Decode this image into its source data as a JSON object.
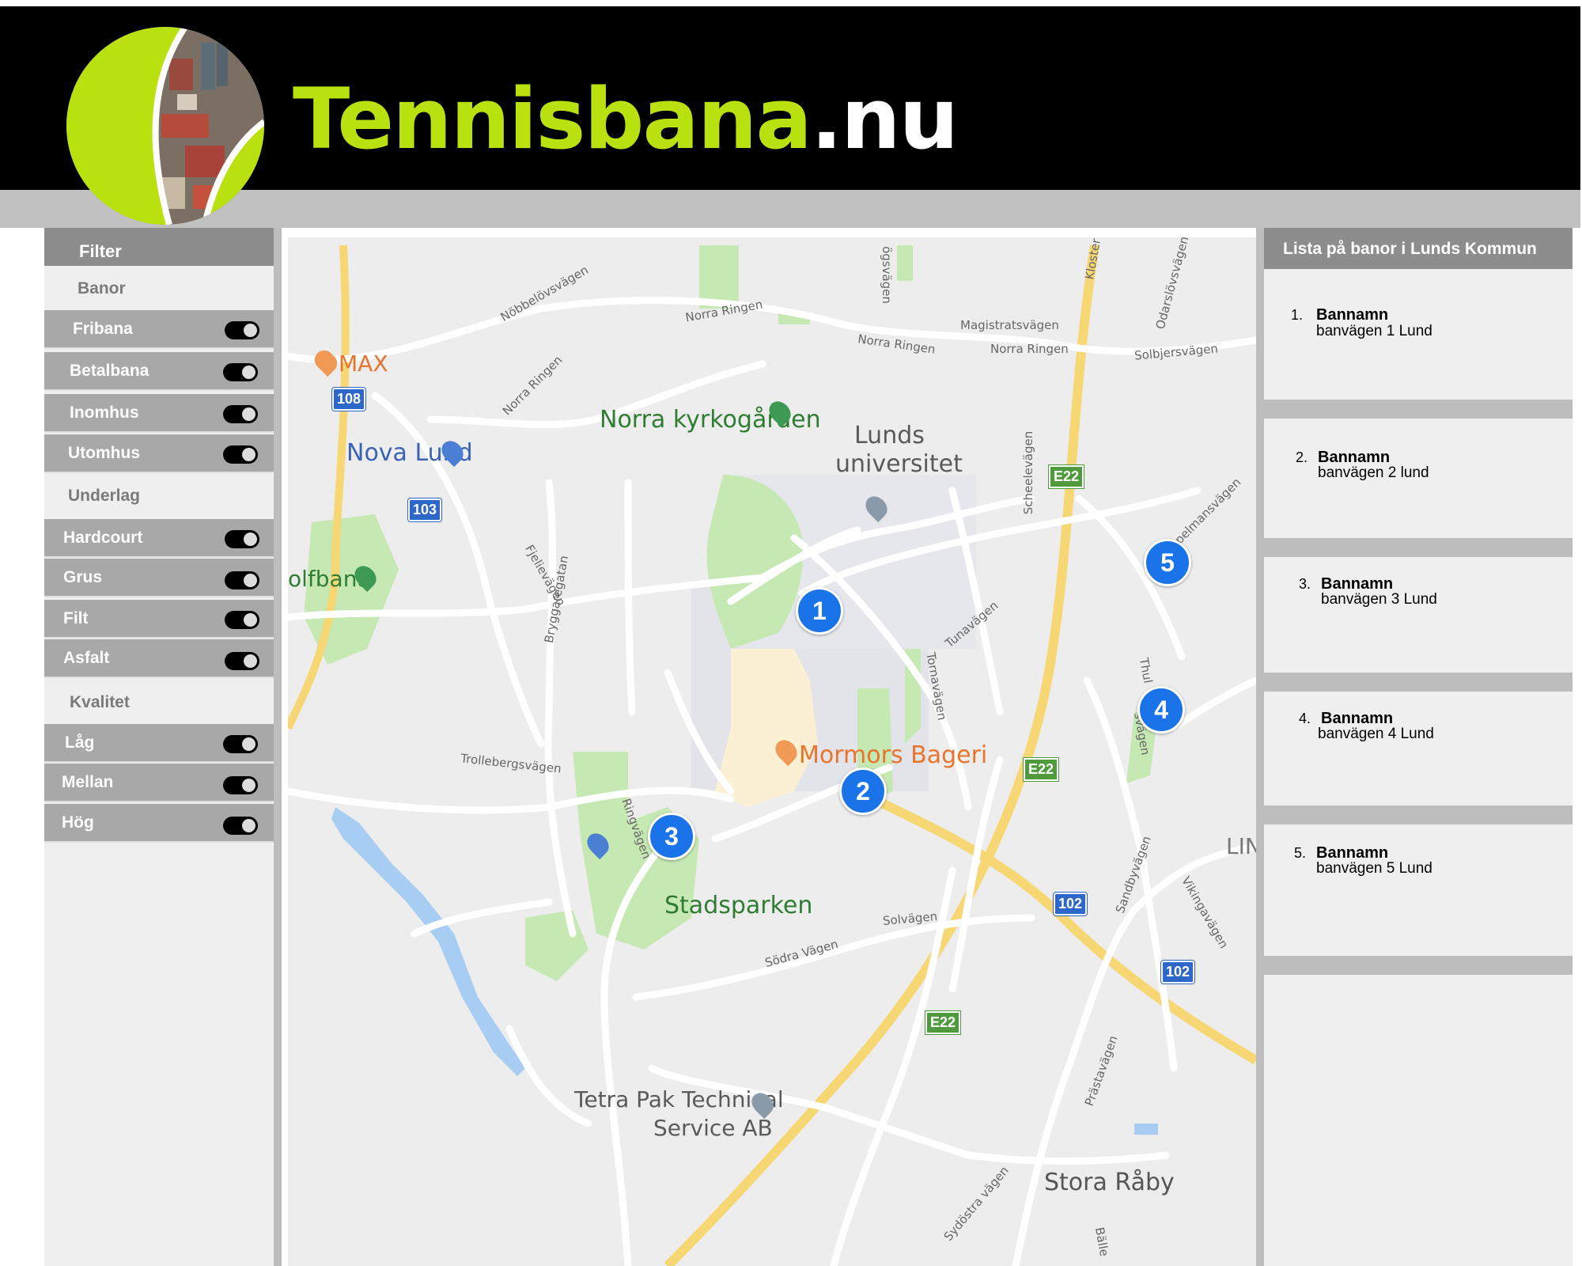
{
  "site": {
    "title_name": "Tennisbana",
    "title_tld": ".nu"
  },
  "filter": {
    "heading": "Filter",
    "sections": [
      {
        "label": "Banor",
        "items": [
          {
            "label": "Fribana",
            "on": true
          },
          {
            "label": "Betalbana",
            "on": true
          },
          {
            "label": "Inomhus",
            "on": true
          },
          {
            "label": "Utomhus",
            "on": true
          }
        ]
      },
      {
        "label": "Underlag",
        "items": [
          {
            "label": "Hardcourt",
            "on": true
          },
          {
            "label": "Grus",
            "on": true
          },
          {
            "label": "Filt",
            "on": true
          },
          {
            "label": "Asfalt",
            "on": true
          }
        ]
      },
      {
        "label": "Kvalitet",
        "items": [
          {
            "label": "Låg",
            "on": true
          },
          {
            "label": "Mellan",
            "on": true
          },
          {
            "label": "Hög",
            "on": true
          }
        ]
      }
    ]
  },
  "map": {
    "places": {
      "max": "MAX",
      "nova_lund": "Nova Lund",
      "golfbana": "olfbana",
      "norra_kyrkogarden": "Norra kyrkogården",
      "lunds_universitet_1": "Lunds",
      "lunds_universitet_2": "universitet",
      "mormors_bageri": "Mormors Bageri",
      "stadsparken": "Stadsparken",
      "tetra_pak_1": "Tetra Pak Technical",
      "tetra_pak_2": "Service AB",
      "stora_raby": "Stora Råby",
      "lin": "LIN"
    },
    "streets": {
      "nobbelovsvagen": "Nöbbelövsvägen",
      "norra_ringen_top": "Norra Ringen",
      "norra_ringen_mid": "Norra Ringen",
      "norra_ringen_right": "Norra Ringen",
      "norra_ringen_left": "Norra Ringen",
      "magistratsvagen": "Magistratsvägen",
      "solbjersvagen": "Solbjersvägen",
      "ogsvagen": "ögsvägen",
      "klostergatan": "Kloster",
      "odarslovsvagen": "Odarslövsvägen",
      "scheelevagen": "Scheelevägen",
      "fjelievagen": "Fjelievägen",
      "bryggaregatan": "Bryggaregatan",
      "tunavagen": "Tunavägen",
      "tornavagen": "Tornavägen",
      "spelmansvagen": "Spelmansvägen",
      "thulevagen_1": "Thul",
      "thulevagen_2": "svägen",
      "trollebergsvagen": "Trollebergsvägen",
      "ringvagen": "Ringvägen",
      "solvagen": "Solvägen",
      "sodra_vagen": "Södra Vägen",
      "sandbyvagen": "Sandbyvägen",
      "vikingavagen": "Vikingavägen",
      "prastavagen": "Prästavägen",
      "sydostra_vagen": "Sydöstra vägen",
      "ballev": "Bälle"
    },
    "shields": {
      "r108": "108",
      "r103": "103",
      "e22_a": "E22",
      "e22_b": "E22",
      "e22_c": "E22",
      "r102_a": "102",
      "r102_b": "102"
    },
    "pins": [
      "1",
      "2",
      "3",
      "4",
      "5"
    ]
  },
  "list": {
    "heading": "Lista på banor i Lunds Kommun",
    "courts": [
      {
        "num": "1.",
        "name": "Bannamn",
        "address": "banvägen 1 Lund"
      },
      {
        "num": "2.",
        "name": "Bannamn",
        "address": "banvägen 2 lund"
      },
      {
        "num": "3.",
        "name": "Bannamn",
        "address": "banvägen 3 Lund"
      },
      {
        "num": "4.",
        "name": "Bannamn",
        "address": "banvägen 4 Lund"
      },
      {
        "num": "5.",
        "name": "Bannamn",
        "address": "banvägen 5 Lund"
      }
    ]
  },
  "colors": {
    "brand_green": "#b9e00f",
    "header_bg": "#000000",
    "pin_blue": "#1a73e8"
  }
}
